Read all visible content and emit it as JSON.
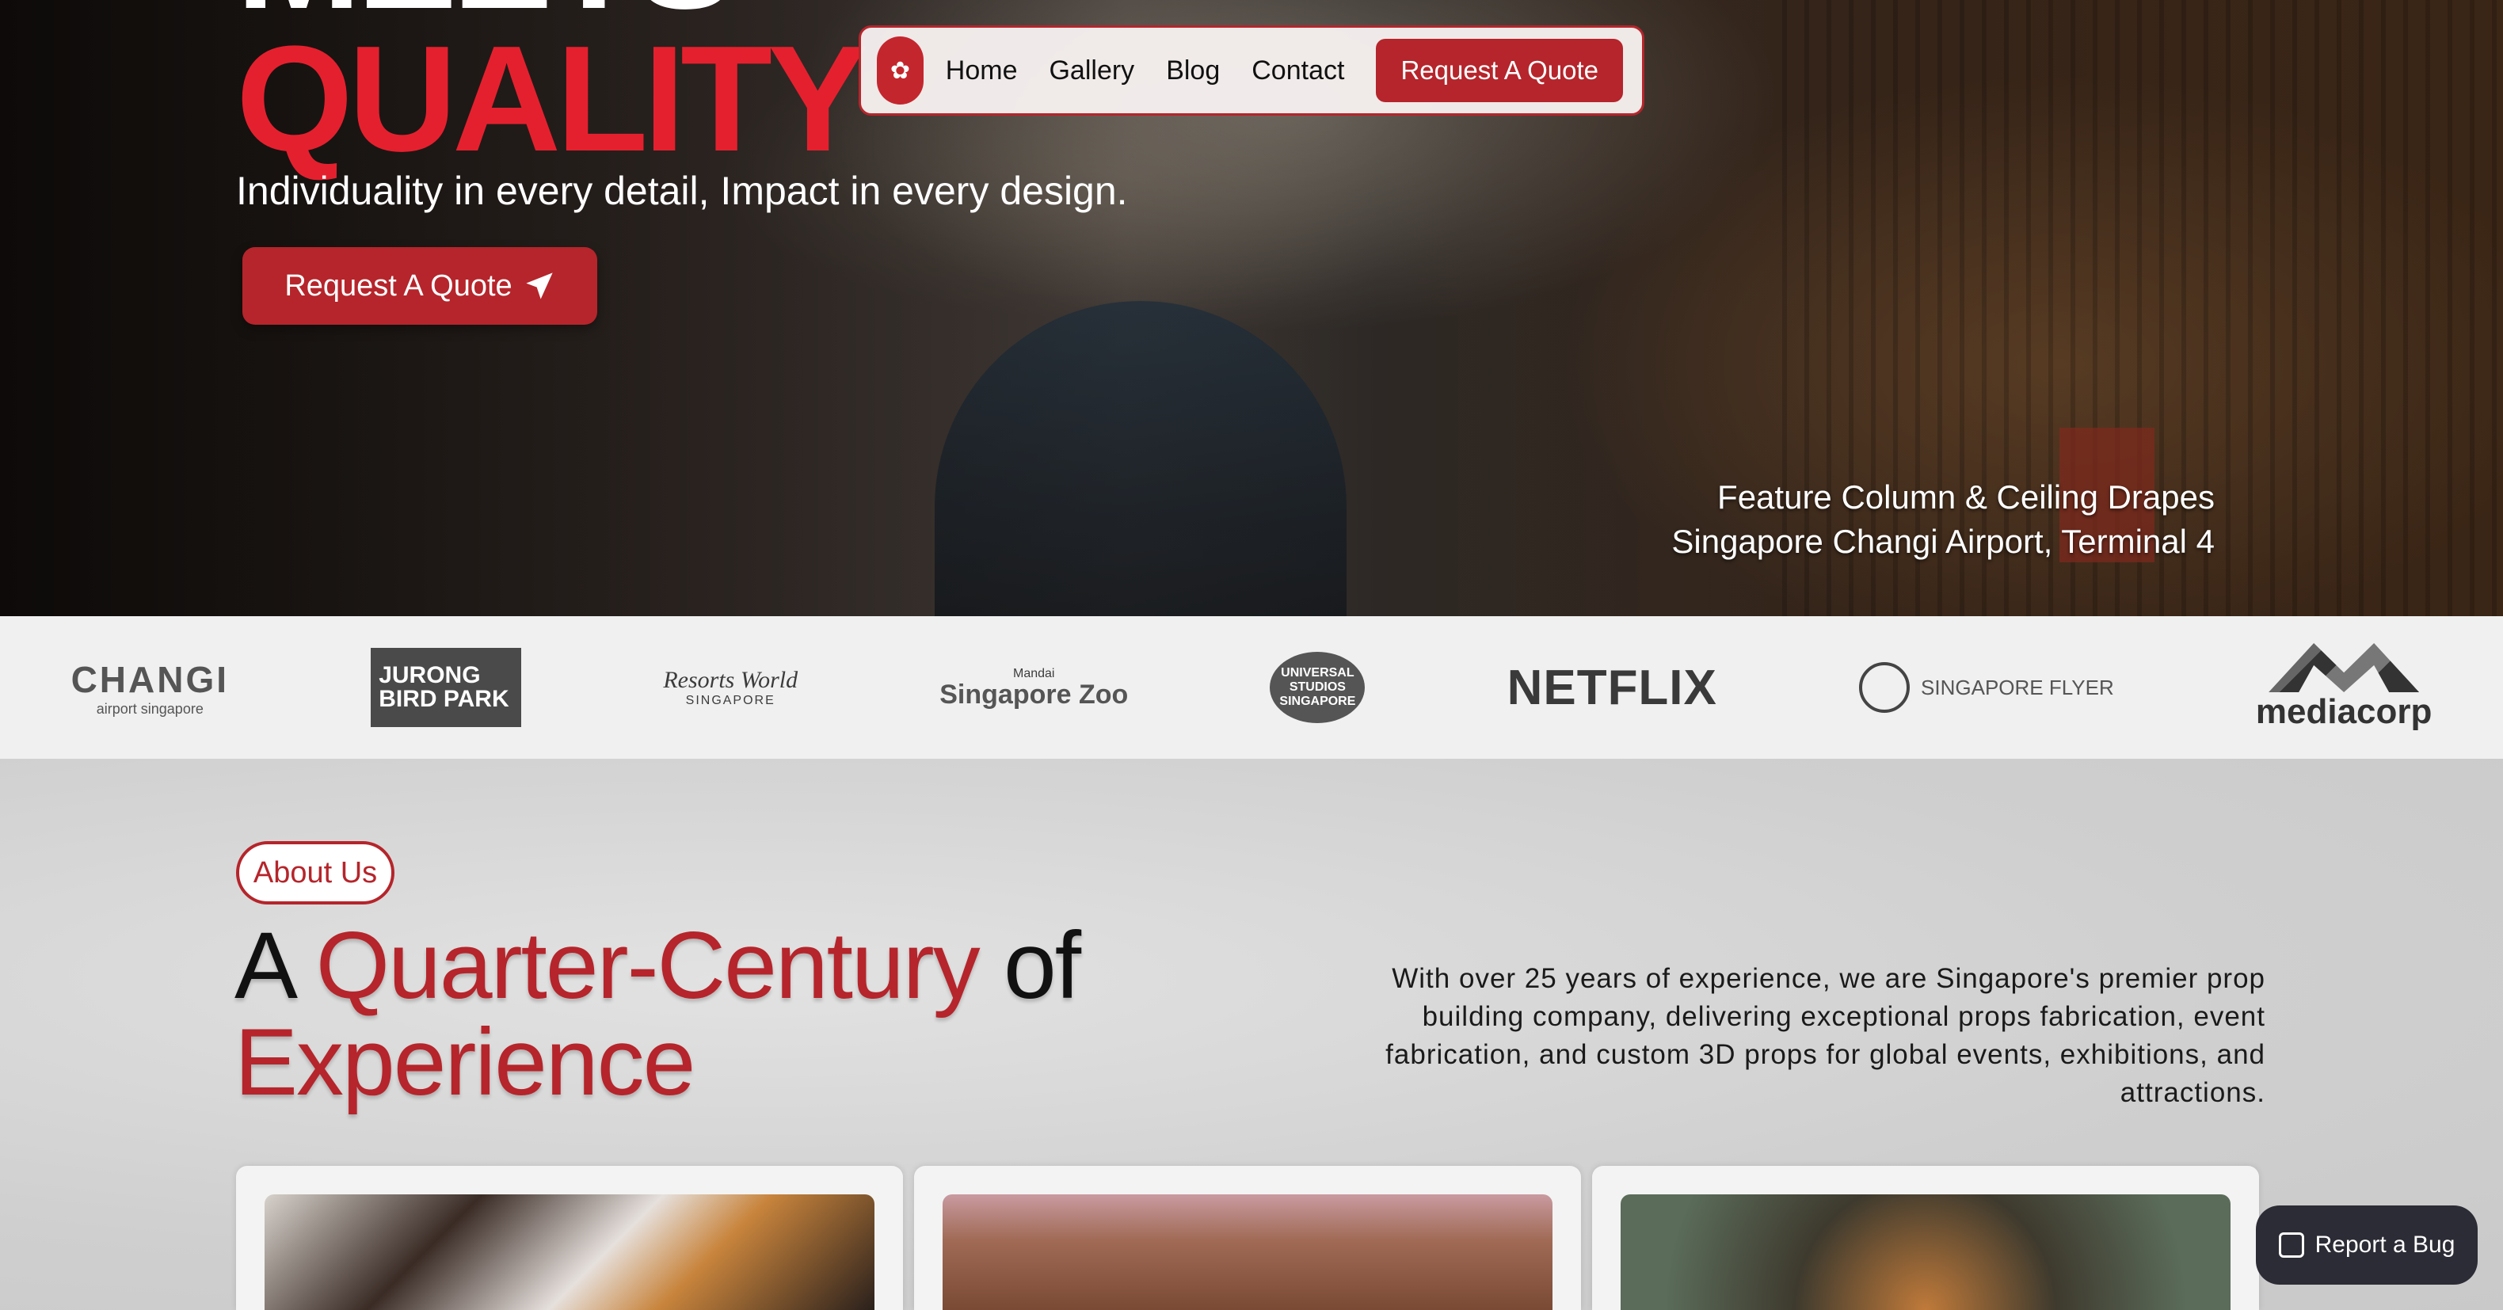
{
  "hero": {
    "headline_top": "MEETS",
    "headline": "QUALITY",
    "tagline": "Individuality in every detail, Impact in every design.",
    "cta_label": "Request A Quote",
    "cta_icon": "paper-plane-icon",
    "caption_line1": "Feature Column & Ceiling Drapes",
    "caption_line2": "Singapore Changi Airport, Terminal 4"
  },
  "nav": {
    "logo_icon": "brand-seal-logo",
    "items": [
      "Home",
      "Gallery",
      "Blog",
      "Contact"
    ],
    "cta_label": "Request A Quote"
  },
  "clients": {
    "changi": {
      "name": "CHANGI",
      "sub": "airport singapore"
    },
    "jurong": {
      "name": "JURONG BIRD PARK"
    },
    "rws": {
      "name": "Resorts World",
      "sub": "SINGAPORE"
    },
    "zoo": {
      "name": "Singapore Zoo",
      "sub": "Mandai"
    },
    "universal": {
      "name": "UNIVERSAL STUDIOS SINGAPORE"
    },
    "netflix": {
      "name": "NETFLIX"
    },
    "flyer": {
      "name": "SINGAPORE FLYER"
    },
    "mediacorp": {
      "name": "mediacorp"
    }
  },
  "about": {
    "pill": "About Us",
    "title_a": "A ",
    "title_red1": "Quarter-Century",
    "title_of": " of",
    "title_red2": "Experience",
    "body": "With over 25 years of experience, we are Singapore's premier prop building company, delivering exceptional props fabrication, event fabrication, and custom 3D props for global events, exhibitions, and attractions."
  },
  "report_bug": {
    "label": "Report a Bug",
    "icon": "megaphone-icon"
  },
  "colors": {
    "accent_red": "#b5252b",
    "headline_red": "#e5202e",
    "bug_bg": "#2c2c36"
  }
}
